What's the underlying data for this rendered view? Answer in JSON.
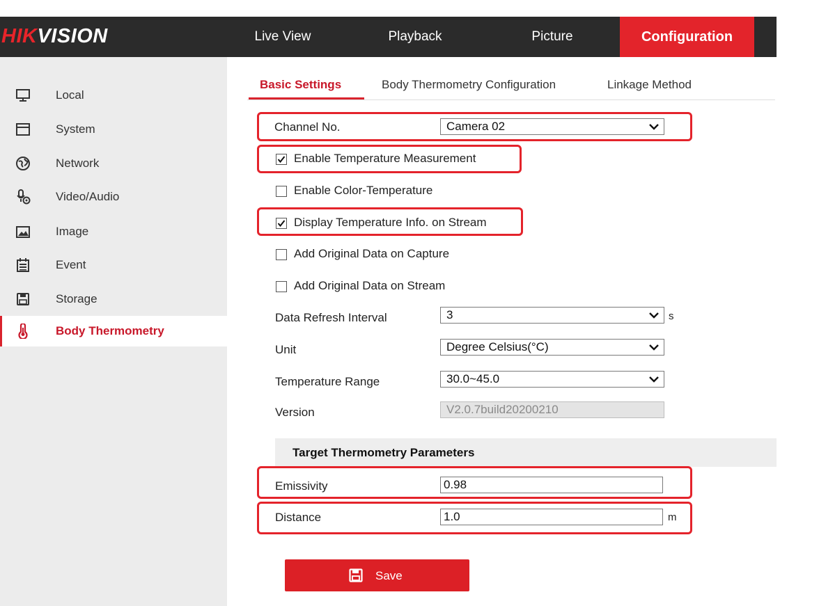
{
  "brand": {
    "logo_part1": "HIK",
    "logo_part2": "VISION"
  },
  "nav": [
    {
      "label": "Live View"
    },
    {
      "label": "Playback"
    },
    {
      "label": "Picture"
    },
    {
      "label": "Configuration"
    }
  ],
  "sidebar": [
    {
      "label": "Local",
      "icon": "monitor-icon"
    },
    {
      "label": "System",
      "icon": "window-icon"
    },
    {
      "label": "Network",
      "icon": "globe-icon"
    },
    {
      "label": "Video/Audio",
      "icon": "microphone-icon"
    },
    {
      "label": "Image",
      "icon": "image-icon"
    },
    {
      "label": "Event",
      "icon": "calendar-icon"
    },
    {
      "label": "Storage",
      "icon": "floppy-icon"
    },
    {
      "label": "Body Thermometry",
      "icon": "thermometer-icon"
    }
  ],
  "tabs": [
    {
      "label": "Basic Settings"
    },
    {
      "label": "Body Thermometry Configuration"
    },
    {
      "label": "Linkage Method"
    }
  ],
  "form": {
    "channel_label": "Channel No.",
    "channel_value": "Camera 02",
    "checkboxes": [
      {
        "label": "Enable Temperature Measurement",
        "checked": true
      },
      {
        "label": "Enable Color-Temperature",
        "checked": false
      },
      {
        "label": "Display Temperature Info. on Stream",
        "checked": true
      },
      {
        "label": "Add Original Data on Capture",
        "checked": false
      },
      {
        "label": "Add Original Data on Stream",
        "checked": false
      }
    ],
    "refresh_label": "Data Refresh Interval",
    "refresh_value": "3",
    "refresh_unit": "s",
    "unit_label": "Unit",
    "unit_value": "Degree Celsius(°C)",
    "range_label": "Temperature Range",
    "range_value": "30.0~45.0",
    "version_label": "Version",
    "version_value": "V2.0.7build20200210"
  },
  "target": {
    "heading": "Target Thermometry Parameters",
    "emissivity_label": "Emissivity",
    "emissivity_value": "0.98",
    "distance_label": "Distance",
    "distance_value": "1.0",
    "distance_unit": "m"
  },
  "save_label": "Save",
  "colors": {
    "accent": "#e3242b",
    "topbar": "#2b2b2b",
    "sidebar": "#ececec"
  }
}
